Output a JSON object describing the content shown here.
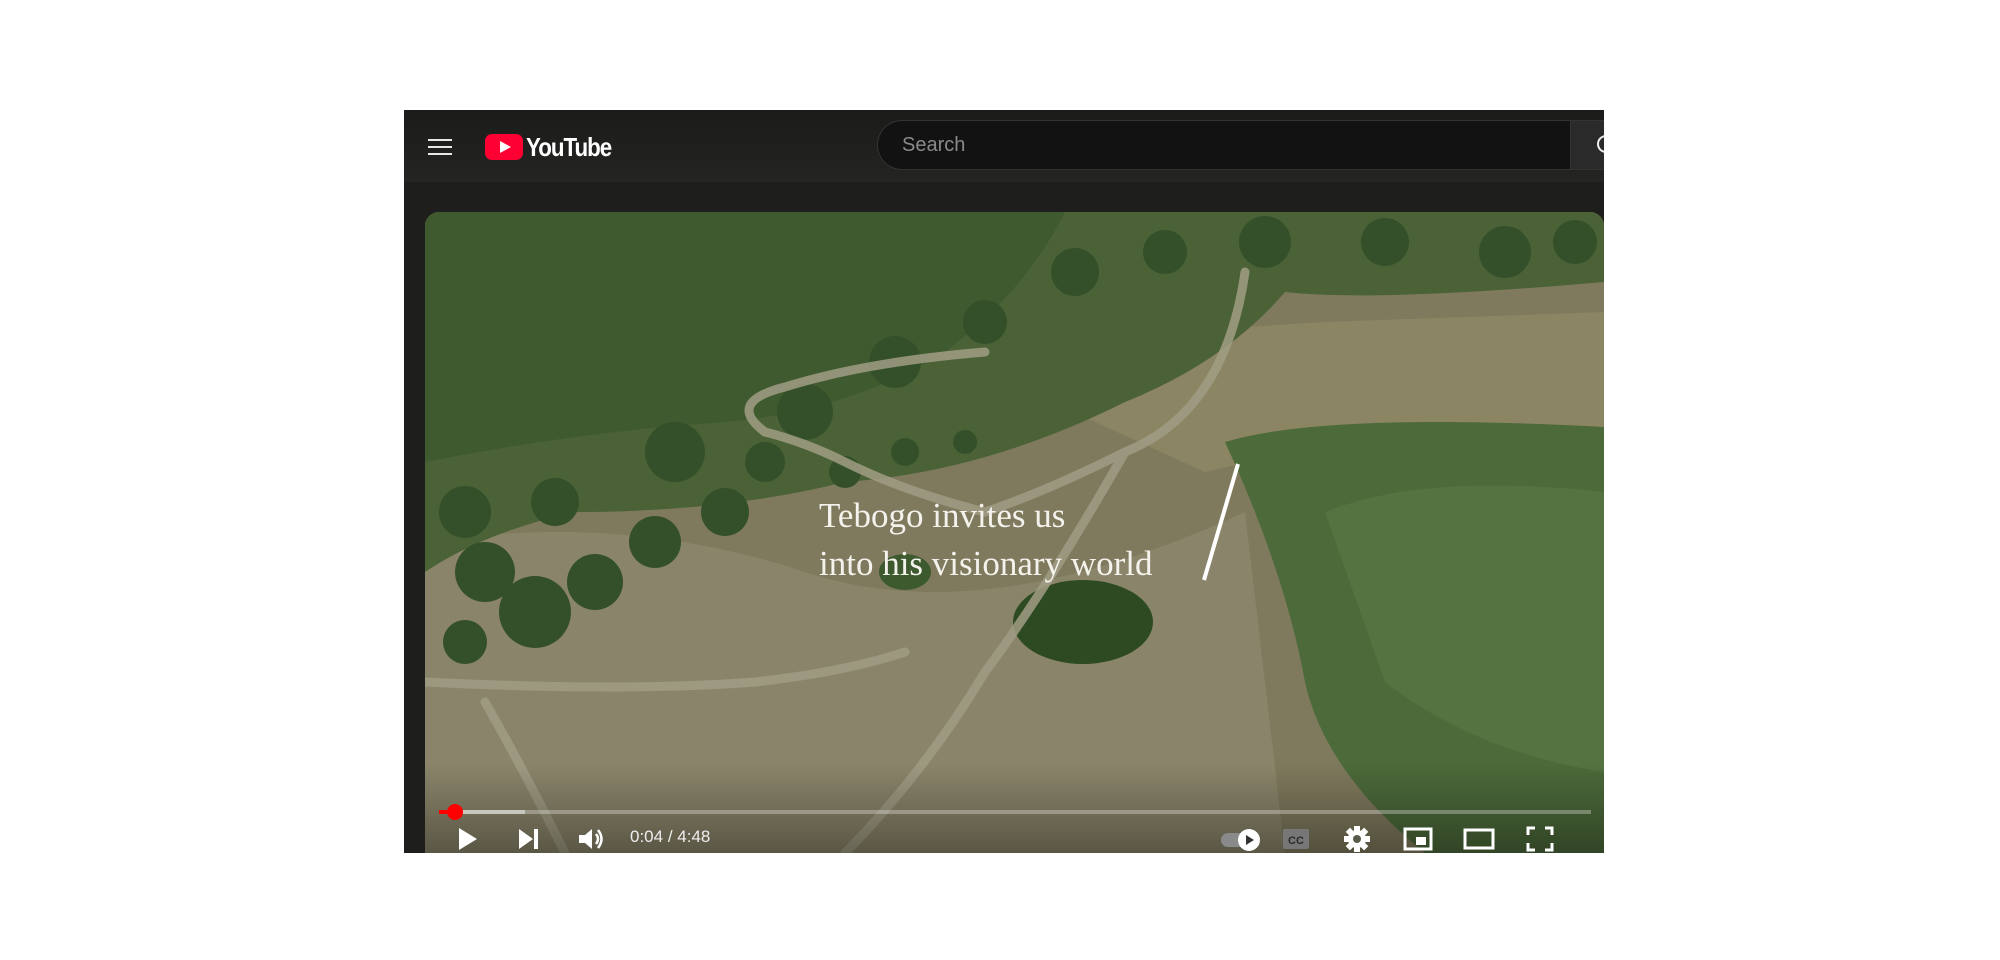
{
  "header": {
    "menu_icon": "hamburger-menu-icon",
    "logo_text": "YouTube",
    "logo_color": "#ff0033",
    "search_placeholder": "Search",
    "search_icon": "search-icon"
  },
  "player": {
    "caption_line1": "Tebogo invites us",
    "caption_line2": "into his visionary world",
    "current_time": "0:04",
    "duration": "4:48",
    "time_display": "0:04 / 4:48",
    "played_fraction": 0.014,
    "buffered_fraction": 0.075,
    "progress_color": "#ff0000",
    "controls_left": [
      "play-icon",
      "next-icon",
      "volume-icon"
    ],
    "controls_right": [
      "autoplay-toggle-icon",
      "subtitles-cc-icon",
      "settings-gear-icon",
      "miniplayer-icon",
      "theater-mode-icon",
      "fullscreen-icon"
    ],
    "cc_label": "CC"
  }
}
